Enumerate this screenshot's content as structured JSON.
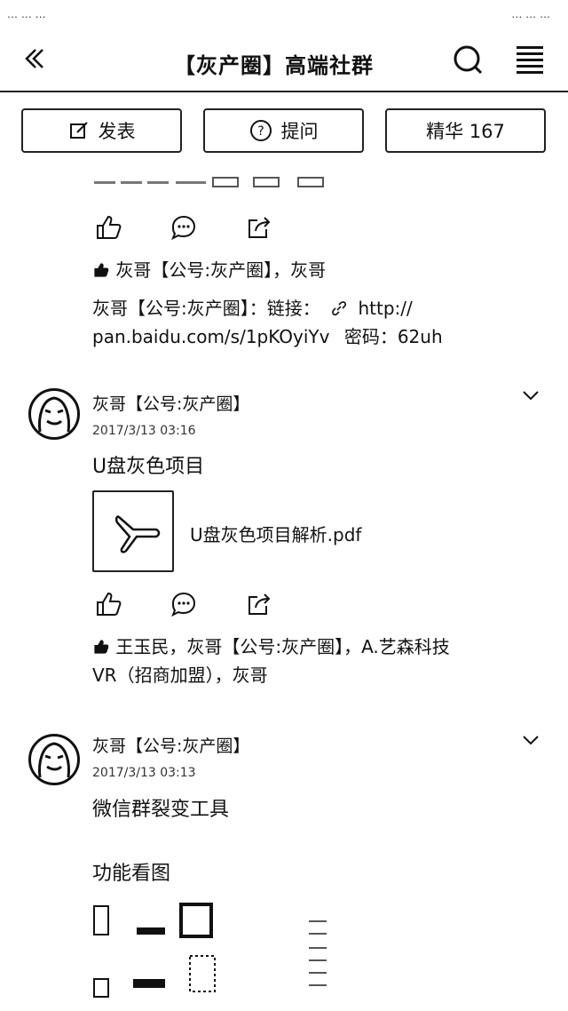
{
  "status": {
    "left": "…  …  …",
    "right": "…  …  …"
  },
  "nav": {
    "title": "【灰产圈】高端社群"
  },
  "toolbar": {
    "post": "发表",
    "ask": "提问",
    "featured": "精华 167"
  },
  "post1": {
    "likes": "灰哥【公号:灰产圈】，灰哥",
    "comment_line1": "灰哥【公号:灰产圈】：链接：",
    "link_line1": "http://",
    "link_line2": "pan.baidu.com/s/1pKOyiYv",
    "pwd": "密码：62uh"
  },
  "post2": {
    "author": "灰哥【公号:灰产圈】",
    "time": "2017/3/13 03:16",
    "title": "U盘灰色项目",
    "file_name": "U盘灰色项目解析.pdf",
    "likes_line1": "王玉民，灰哥【公号:灰产圈】，A.艺森科技",
    "likes_line2": "VR（招商加盟），灰哥"
  },
  "post3": {
    "author": "灰哥【公号:灰产圈】",
    "time": "2017/3/13 03:13",
    "title": "微信群裂变工具",
    "subtitle": "功能看图"
  }
}
